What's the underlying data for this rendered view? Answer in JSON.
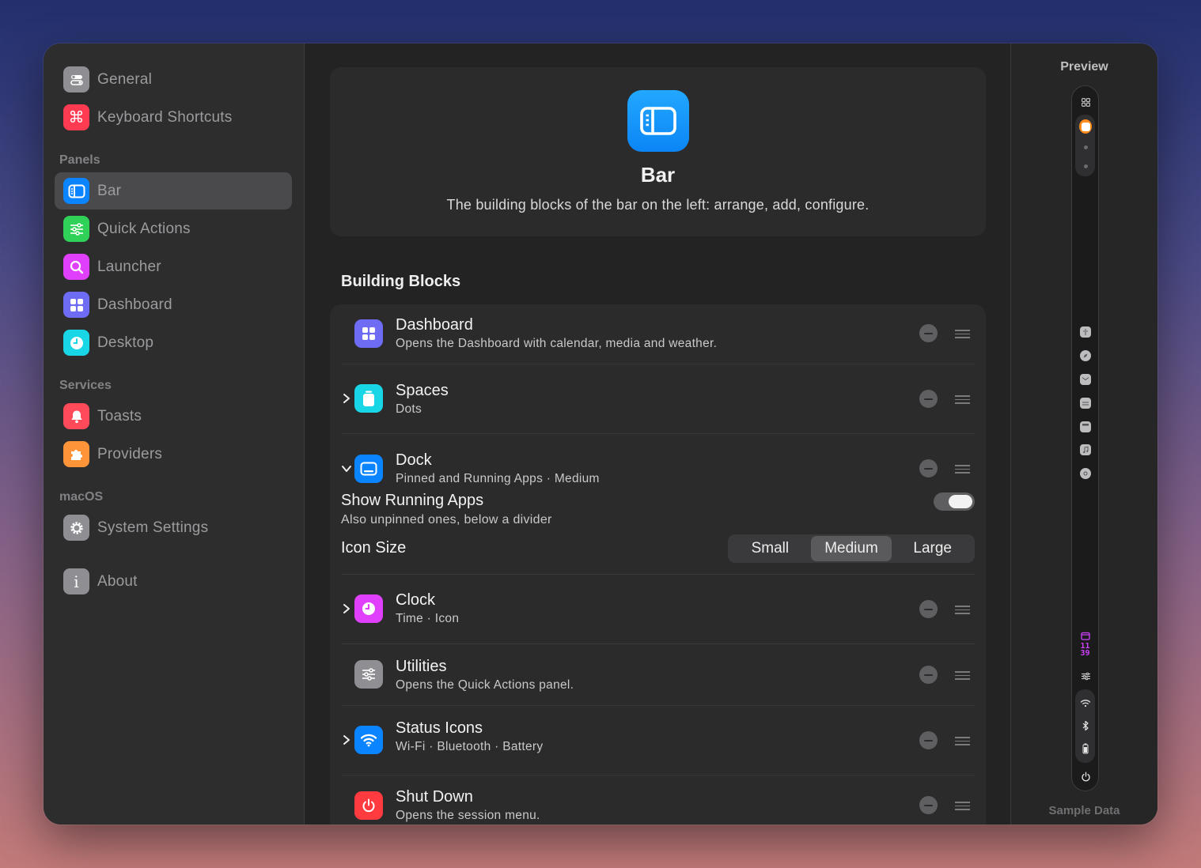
{
  "sidebar": {
    "general": "General",
    "keyboard_shortcuts": "Keyboard Shortcuts",
    "panels_header": "Panels",
    "bar": "Bar",
    "quick_actions": "Quick Actions",
    "launcher": "Launcher",
    "dashboard": "Dashboard",
    "desktop": "Desktop",
    "services_header": "Services",
    "toasts": "Toasts",
    "providers": "Providers",
    "macos_header": "macOS",
    "system_settings": "System Settings",
    "about": "About"
  },
  "hero": {
    "title": "Bar",
    "subtitle": "The building blocks of the bar on the left: arrange, add, configure."
  },
  "blocks": {
    "section_title": "Building Blocks",
    "dashboard": {
      "title": "Dashboard",
      "subtitle": "Opens the Dashboard with calendar, media and weather."
    },
    "spaces": {
      "title": "Spaces",
      "subtitle": "Dots"
    },
    "dock": {
      "title": "Dock",
      "subtitle": "Pinned and Running Apps · Medium",
      "show_running_label": "Show Running Apps",
      "show_running_sub": "Also unpinned ones, below a divider",
      "show_running_on": true,
      "icon_size_label": "Icon Size",
      "sizes": [
        "Small",
        "Medium",
        "Large"
      ],
      "selected_size": "Medium"
    },
    "clock": {
      "title": "Clock",
      "subtitle": "Time · Icon"
    },
    "utilities": {
      "title": "Utilities",
      "subtitle": "Opens the Quick Actions panel."
    },
    "status_icons": {
      "title": "Status Icons",
      "subtitle": "Wi-Fi · Bluetooth · Battery"
    },
    "shut_down": {
      "title": "Shut Down",
      "subtitle": "Opens the session menu."
    }
  },
  "preview": {
    "title": "Preview",
    "footer": "Sample Data",
    "clock_hours": "11",
    "clock_minutes": "39"
  },
  "colors": {
    "accent_blue": "#0a84ff",
    "general_gray": "#8e8e93",
    "keyboard_red": "#ff3b52",
    "quick_actions_green": "#30d158",
    "launcher_magenta": "#e040fb",
    "dashboard_indigo": "#6e6cf5",
    "desktop_cyan": "#18d6e6",
    "toasts_red": "#ff4a5a",
    "providers_orange": "#ff9538",
    "shutdown_red": "#ff3b40",
    "active_space_orange": "#ff8c1a"
  }
}
